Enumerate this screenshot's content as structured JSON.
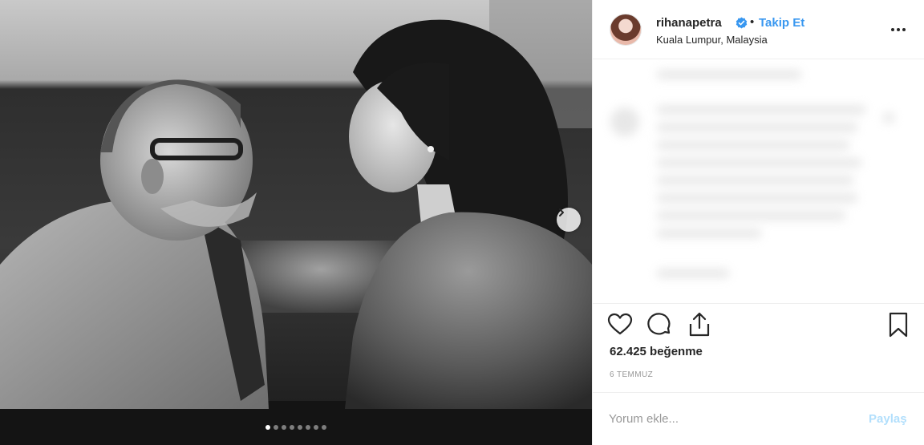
{
  "post": {
    "username": "rihanapetra",
    "separator": "•",
    "follow_label": "Takip Et",
    "location": "Kuala Lumpur, Malaysia",
    "likes_text": "62.425 beğenme",
    "date_text": "6 TEMMUZ"
  },
  "carousel": {
    "total_slides": 8,
    "active_index": 0
  },
  "comment": {
    "placeholder": "Yorum ekle...",
    "post_label": "Paylaş"
  },
  "colors": {
    "accent": "#3897f0",
    "post_disabled": "#b2dffc",
    "text": "#262626",
    "muted": "#999999",
    "divider": "#efefef"
  },
  "icons": {
    "verified": "verified-badge-icon",
    "more": "more-options-icon",
    "like": "heart-icon",
    "comment": "comment-bubble-icon",
    "share": "share-icon",
    "save": "bookmark-icon",
    "next": "chevron-right-icon"
  }
}
